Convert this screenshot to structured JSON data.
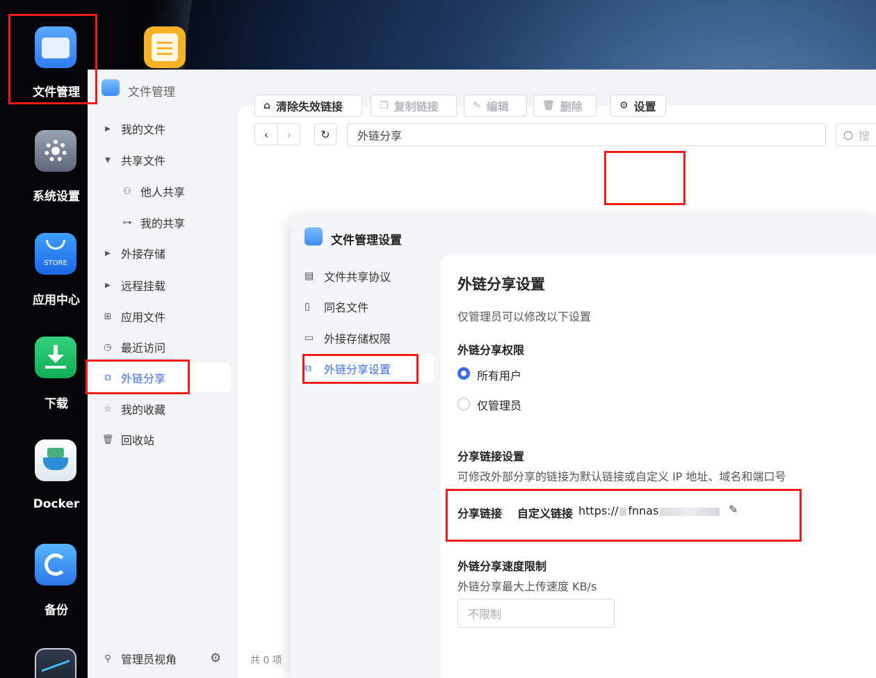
{
  "dock": {
    "items": [
      {
        "label": "文件管理",
        "icon": "folder-icon"
      },
      {
        "label": "系统设置",
        "icon": "gear-icon"
      },
      {
        "label": "应用中心",
        "icon": "store-icon",
        "badge": "STORE"
      },
      {
        "label": "下载",
        "icon": "download-icon"
      },
      {
        "label": "Docker",
        "icon": "docker-icon"
      },
      {
        "label": "备份",
        "icon": "backup-icon"
      }
    ]
  },
  "window": {
    "title": "文件管理",
    "sidebar": {
      "items": [
        {
          "label": "我的文件",
          "icon": "caret-right-icon"
        },
        {
          "label": "共享文件",
          "icon": "caret-down-icon"
        },
        {
          "label": "他人共享",
          "icon": "users-icon"
        },
        {
          "label": "我的共享",
          "icon": "share-nodes-icon"
        },
        {
          "label": "外接存储",
          "icon": "caret-right-icon"
        },
        {
          "label": "远程挂载",
          "icon": "caret-right-icon"
        },
        {
          "label": "应用文件",
          "icon": "grid-icon"
        },
        {
          "label": "最近访问",
          "icon": "clock-icon"
        },
        {
          "label": "外链分享",
          "icon": "external-share-icon"
        },
        {
          "label": "我的收藏",
          "icon": "star-icon"
        },
        {
          "label": "回收站",
          "icon": "trash-icon"
        }
      ],
      "footer_label": "管理员视角"
    },
    "path": "外链分享",
    "search_placeholder": "搜",
    "toolbar": {
      "clear": "清除失效链接",
      "copy": "复制链接",
      "edit": "编辑",
      "delete": "删除",
      "settings": "设置"
    },
    "status": "共 0 项"
  },
  "dialog": {
    "title": "文件管理设置",
    "nav": [
      {
        "label": "文件共享协议",
        "icon": "doc-icon"
      },
      {
        "label": "同名文件",
        "icon": "file-icon"
      },
      {
        "label": "外接存储权限",
        "icon": "drive-icon"
      },
      {
        "label": "外链分享设置",
        "icon": "external-share-icon"
      }
    ],
    "heading": "外链分享设置",
    "note": "仅管理员可以修改以下设置",
    "perm_title": "外链分享权限",
    "perm_options": [
      "所有用户",
      "仅管理员"
    ],
    "perm_selected": 0,
    "link_title": "分享链接设置",
    "link_desc": "可修改外部分享的链接为默认链接或自定义 IP 地址、域名和端口号",
    "link_label": "分享链接",
    "link_type": "自定义链接",
    "link_value": "https://",
    "link_host": "fnnas",
    "speed_title": "外链分享速度限制",
    "speed_desc": "外链分享最大上传速度 KB/s",
    "speed_placeholder": "不限制"
  },
  "colors": {
    "accent": "#3b6ee6",
    "highlight": "#f01c1c"
  }
}
